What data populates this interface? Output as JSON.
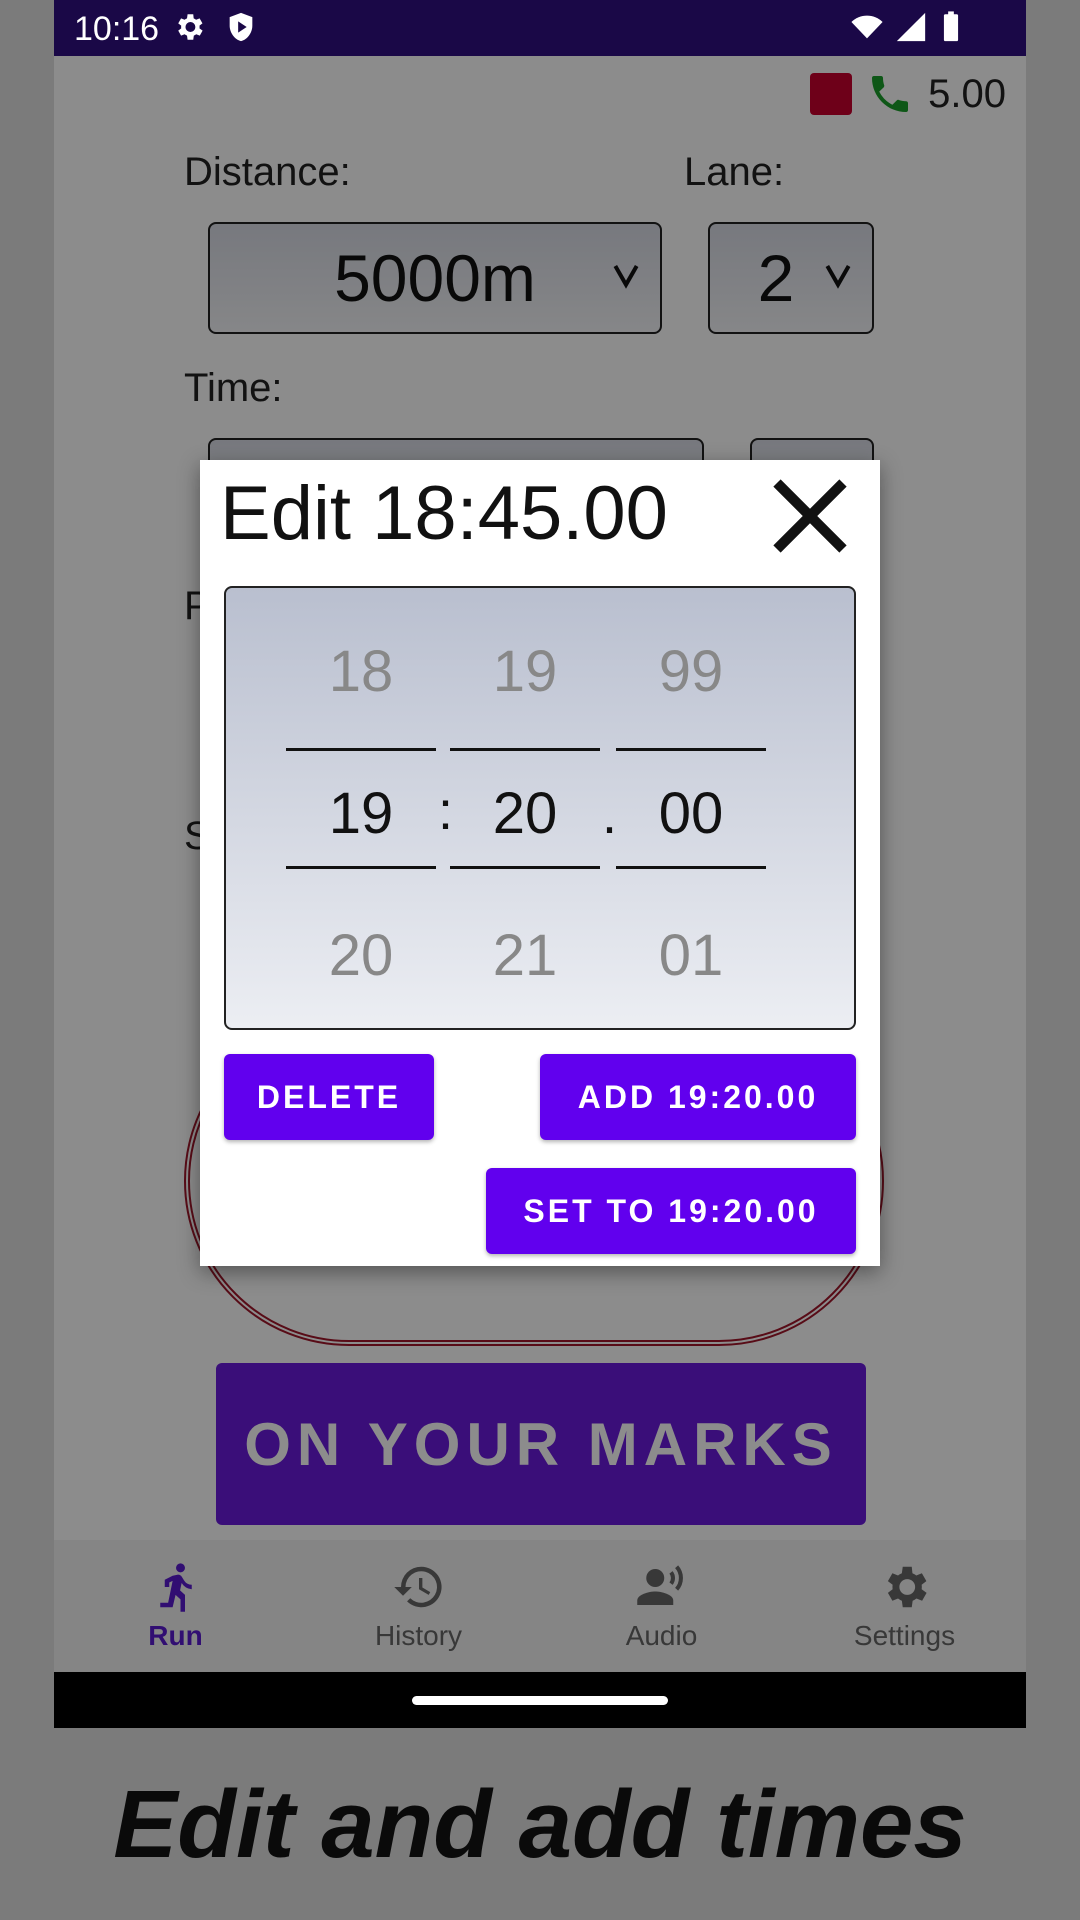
{
  "status": {
    "time": "10:16"
  },
  "header": {
    "value": "5.00"
  },
  "form": {
    "distance_label": "Distance:",
    "distance_value": "5000m",
    "lane_label": "Lane:",
    "lane_value": "2",
    "time_label": "Time:",
    "partial_label_p": "P",
    "partial_label_s": "S"
  },
  "start_button": "ON YOUR MARKS",
  "nav": [
    {
      "label": "Run",
      "icon": "run-icon",
      "active": true
    },
    {
      "label": "History",
      "icon": "history-icon",
      "active": false
    },
    {
      "label": "Audio",
      "icon": "audio-icon",
      "active": false
    },
    {
      "label": "Settings",
      "icon": "gear-icon",
      "active": false
    }
  ],
  "dialog": {
    "title": "Edit 18:45.00",
    "picker": {
      "minutes": {
        "prev": "18",
        "selected": "19",
        "next": "20"
      },
      "seconds": {
        "prev": "19",
        "selected": "20",
        "next": "21"
      },
      "hundredths": {
        "prev": "99",
        "selected": "00",
        "next": "01"
      },
      "sep1": ":",
      "sep2": "."
    },
    "delete_label": "DELETE",
    "add_label": "ADD 19:20.00",
    "set_label": "SET TO 19:20.00"
  },
  "caption": "Edit and add times",
  "colors": {
    "accent": "#6100ee",
    "statusbar": "#1a0847",
    "record": "#c8002f",
    "phone_icon": "#1a9e2a"
  }
}
